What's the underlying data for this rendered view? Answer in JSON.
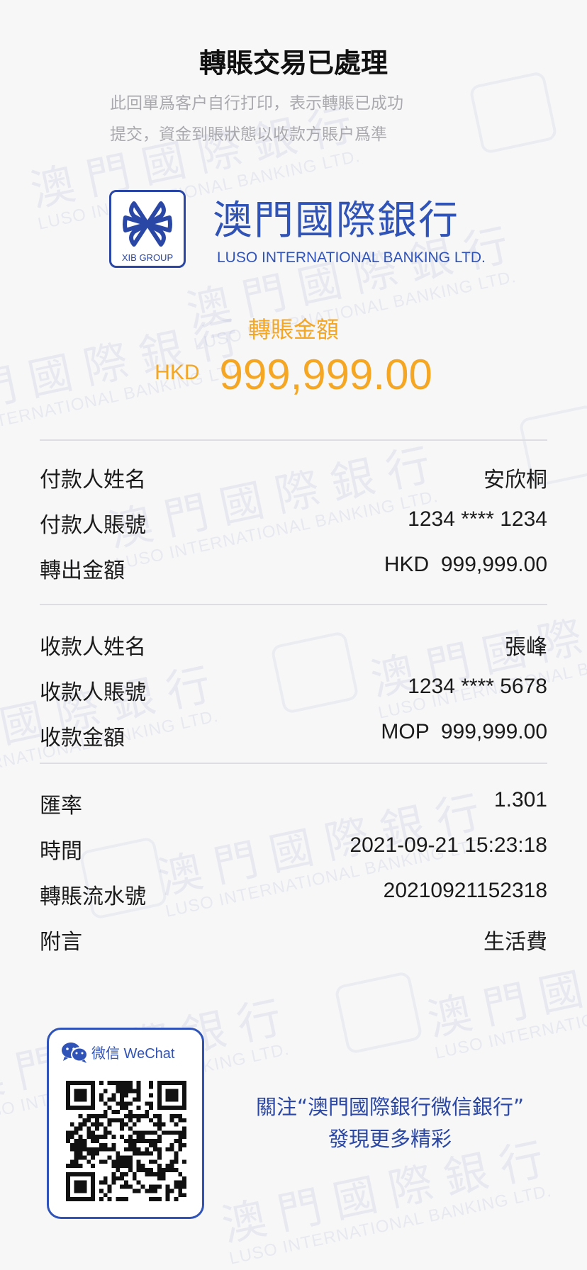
{
  "header": {
    "title": "轉賬交易已處理",
    "subtitle_line1": "此回單爲客户自行打印，表示轉賬已成功",
    "subtitle_line2": "提交，資金到賬狀態以收款方賬户爲準"
  },
  "bank": {
    "name_zh": "澳門國際銀行",
    "name_en": "LUSO INTERNATIONAL BANKING LTD.",
    "logo_tag": "XIB GROUP",
    "brand_color": "#3053b8"
  },
  "amount": {
    "label": "轉賬金額",
    "currency": "HKD",
    "value": "999,999.00",
    "accent_color": "#f5a623"
  },
  "payer": {
    "name_label": "付款人姓名",
    "name_value": "安欣桐",
    "account_label": "付款人賬號",
    "account_value": "1234 **** 1234",
    "amount_label": "轉出金額",
    "amount_value": "HKD  999,999.00"
  },
  "payee": {
    "name_label": "收款人姓名",
    "name_value": "張峰",
    "account_label": "收款人賬號",
    "account_value": "1234 **** 5678",
    "amount_label": "收款金額",
    "amount_value": "MOP  999,999.00"
  },
  "details": {
    "rate_label": "匯率",
    "rate_value": "1.301",
    "time_label": "時間",
    "time_value": "2021-09-21 15:23:18",
    "serial_label": "轉賬流水號",
    "serial_value": "20210921152318",
    "memo_label": "附言",
    "memo_value": "生活費"
  },
  "wechat": {
    "header_label": "微信 WeChat",
    "icon": "wechat-icon",
    "follow_line1": "關注“澳門國際銀行微信銀行”",
    "follow_line2": "發現更多精彩"
  }
}
